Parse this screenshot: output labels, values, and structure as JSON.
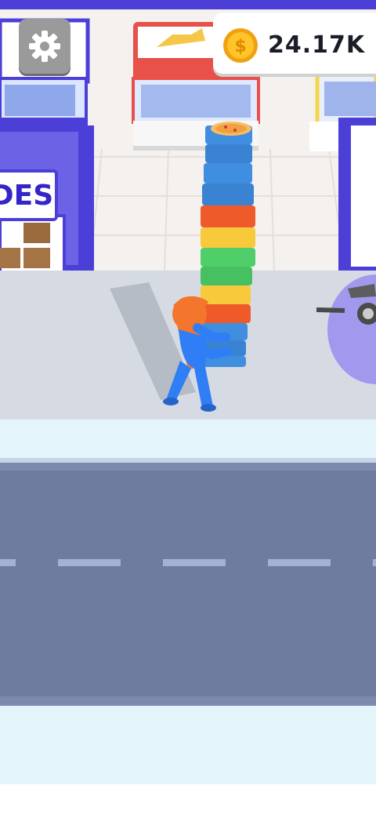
{
  "hud": {
    "settings_icon": "gear-icon",
    "coin_icon": "coin-icon",
    "coin_amount": "24.17K"
  },
  "scene": {
    "store_sign_text": "DES",
    "colors": {
      "ground_tile": "#f4f1ef",
      "sidewalk": "#d6dbe3",
      "curb": "#e3f4fb",
      "road": "#6d7c9f",
      "road_marking": "#a3b2d2",
      "store_purple": "#4b3fd8",
      "store_red": "#e8504a",
      "store_yellow": "#f6d64a",
      "player_blue": "#2f7ef5",
      "player_orange": "#f4752c"
    },
    "pizza_stack_colors": [
      "#3f8ee0",
      "#3f8ee0",
      "#3f8ee0",
      "#3f8ee0",
      "#ef5a2a",
      "#f8c93a",
      "#4fce6a",
      "#4fce6a",
      "#f8c93a",
      "#ef5a2a",
      "#3f8ee0",
      "#3f8ee0",
      "#3f8ee0"
    ]
  }
}
